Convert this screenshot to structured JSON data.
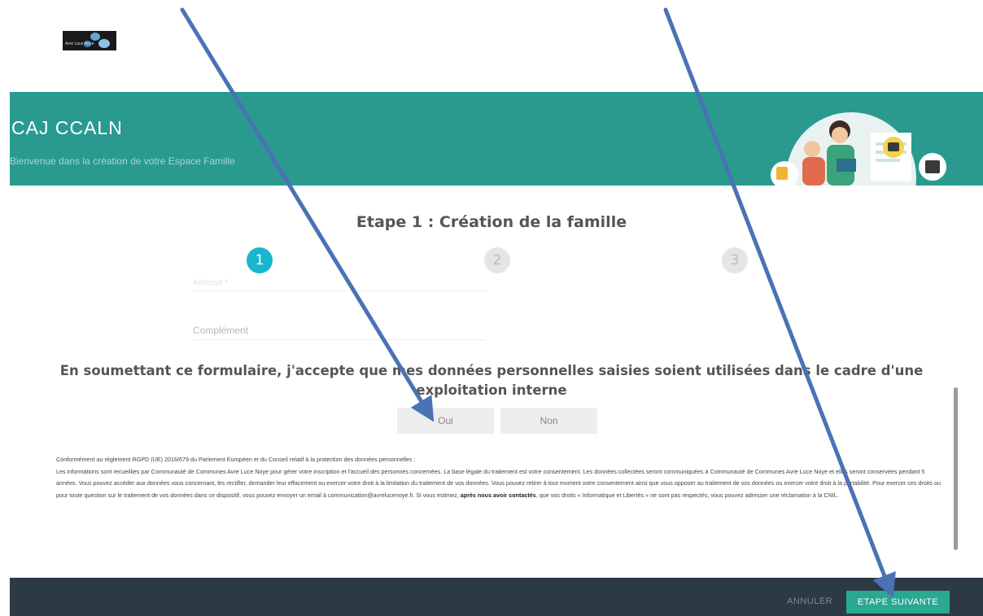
{
  "logo": {
    "text": "Avre Luce Noye"
  },
  "banner": {
    "title": "CAJ CCALN",
    "subtitle": "Bienvenue dans la création de votre Espace Famille"
  },
  "step": {
    "title": "Etape 1 : Création de la famille",
    "numbers": [
      "1",
      "2",
      "3"
    ],
    "active": 1
  },
  "fields": {
    "address_label": "Adresse *",
    "complement_label": "Complément"
  },
  "consent": {
    "text": "En soumettant ce formulaire, j'accepte que mes données personnelles saisies soient utilisées dans le cadre d'une exploitation interne",
    "yes": "Oui",
    "no": "Non"
  },
  "legal": {
    "line1": "Conformément au règlement RGPD (UE) 2016/679 du Parlement Européen et du Conseil relatif à la protection des données personnelles :",
    "line2": "Les informations sont recueillies par Communauté de Communes Avre Luce Noye pour gérer votre inscription et l'accueil des personnes concernées. La base légale du traitement est votre consentement. Les données collectées seront communiquées à Communauté de Communes Avre Luce Noye et elles seront conservées pendant 5 années. Vous pouvez accéder aux données vous concernant, les rectifier, demander leur effacement ou exercer votre droit à la limitation du traitement de vos données. Vous pouvez retirer à tout moment votre consentement ainsi que vous opposer au traitement de vos données ou exercer votre droit à la portabilité. Pour exercer ces droits ou pour toute question sur le traitement de vos données dans ce dispositif, vous pouvez envoyer un email à communication@avrelucenoye.fr. Si vous estimez,",
    "bold1": "après nous avoir contactés",
    "line3": ", que vos droits « Informatique et Libertés » ne sont pas respectés, vous pouvez adresser une réclamation à la CNIL."
  },
  "footer": {
    "cancel": "ANNULER",
    "next": "ETAPE SUIVANTE"
  },
  "colors": {
    "banner": "#2a9a8f",
    "step_active": "#1ab5cf",
    "footer": "#2c3a44",
    "next_button": "#2aa891",
    "arrow": "#4a72b5"
  }
}
